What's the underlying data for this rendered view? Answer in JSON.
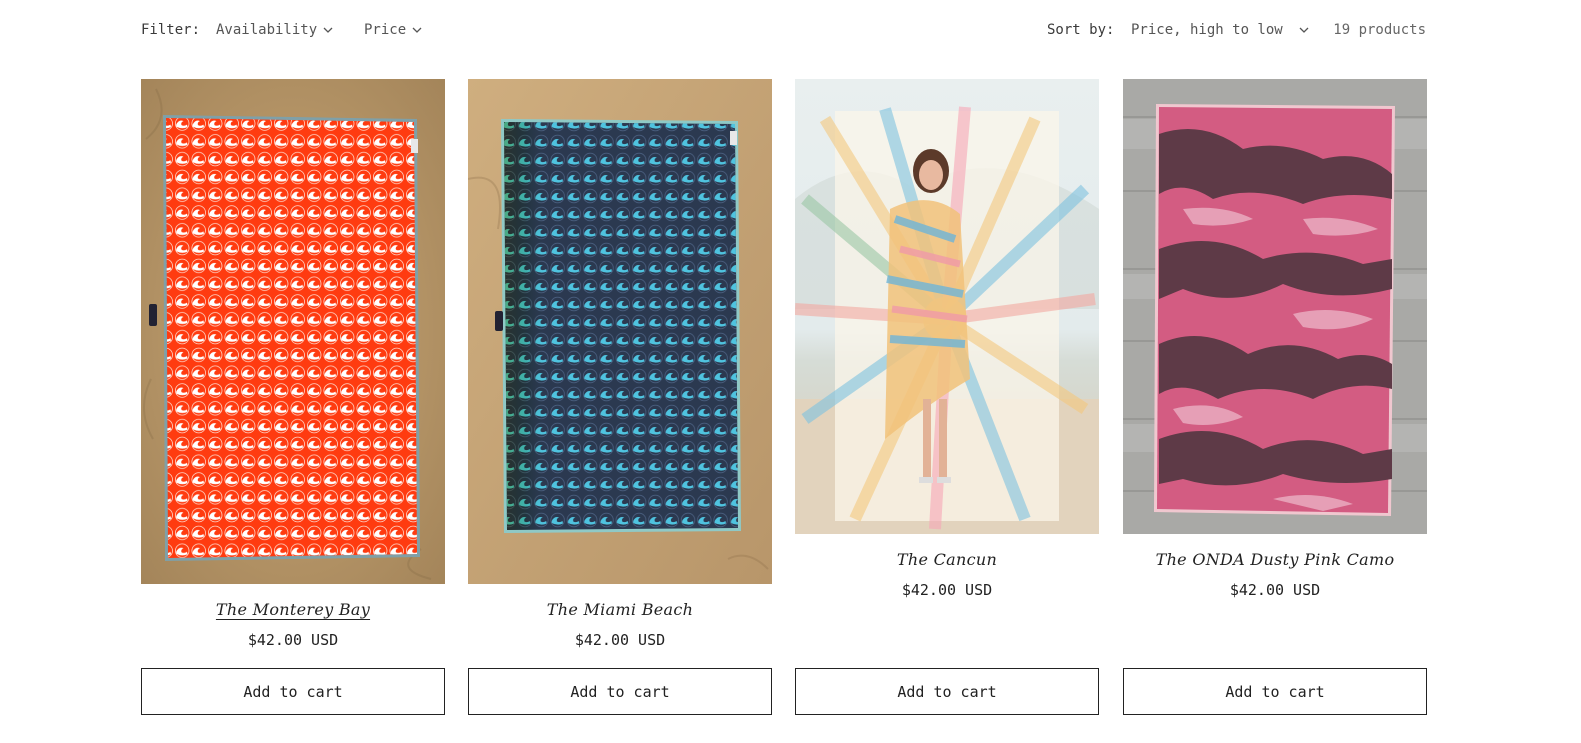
{
  "filter": {
    "label": "Filter:",
    "availability": "Availability",
    "price": "Price"
  },
  "sort": {
    "label": "Sort by:",
    "value": "Price, high to low",
    "count": "19 products"
  },
  "products": [
    {
      "title": "The Monterey Bay",
      "price": "$42.00 USD",
      "button": "Add to cart",
      "image": "orange-wave-towel-on-sand"
    },
    {
      "title": "The Miami Beach",
      "price": "$42.00 USD",
      "button": "Add to cart",
      "image": "navy-wave-towel-on-sand"
    },
    {
      "title": "The Cancun",
      "price": "$42.00 USD",
      "button": "Add to cart",
      "image": "woman-with-sunburst-towel"
    },
    {
      "title": "The ONDA Dusty Pink Camo",
      "price": "$42.00 USD",
      "button": "Add to cart",
      "image": "pink-camo-towel-on-wood"
    }
  ],
  "colors": {
    "orange": "#ff3d12",
    "navy": "#2b3950",
    "sand": "#c8a574",
    "pink": "#d25a80",
    "camo_dark": "#5e3a47",
    "wood": "#a7a7a4"
  }
}
